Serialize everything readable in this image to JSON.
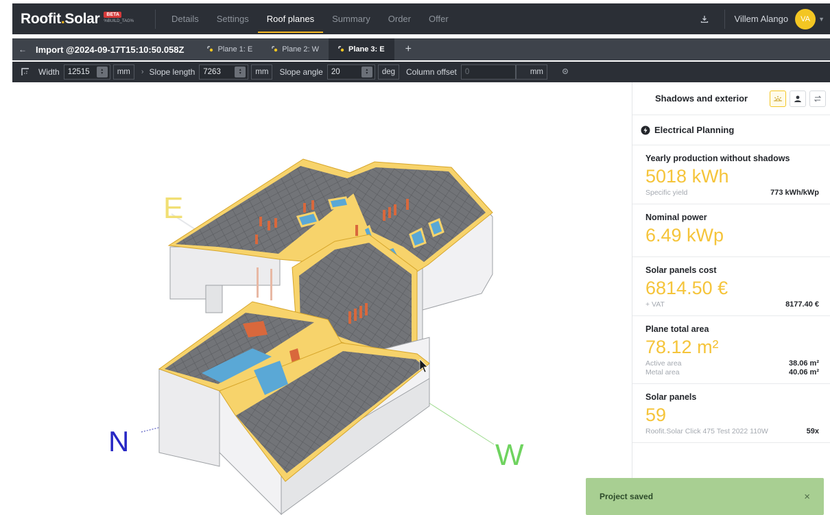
{
  "app": {
    "logo_main": "Roofit",
    "logo_dot": ".",
    "logo_end": "Solar",
    "beta": "BETA",
    "build_tag": "%BUILD_TAG%"
  },
  "nav": {
    "tabs": [
      "Details",
      "Settings",
      "Roof planes",
      "Summary",
      "Order",
      "Offer"
    ],
    "active": "Roof planes",
    "user_name": "Villem Alango",
    "user_initials": "VA"
  },
  "planebar": {
    "import_title": "Import @2024-09-17T15:10:50.058Z",
    "planes": [
      "Plane 1: E",
      "Plane 2: W",
      "Plane 3: E"
    ],
    "active_plane": "Plane 3: E",
    "add_label": "+"
  },
  "toolbar": {
    "width_label": "Width",
    "width_value": "12515",
    "width_unit": "mm",
    "slope_length_label": "Slope length",
    "slope_length_value": "7263",
    "slope_length_unit": "mm",
    "slope_angle_label": "Slope angle",
    "slope_angle_value": "20",
    "slope_angle_unit": "deg",
    "column_offset_label": "Column offset",
    "column_offset_value": "0",
    "column_offset_unit": "mm"
  },
  "viewport": {
    "compass_e": "E",
    "compass_n": "N",
    "compass_w": "W",
    "colors": {
      "roof_edge": "#f7d36b",
      "panel": "#6d6f73",
      "window": "#5aa8d6",
      "chimney": "#d9683c",
      "wall": "#e9eaec"
    }
  },
  "panel": {
    "title": "Shadows and exterior",
    "electrical_planning": "Electrical Planning",
    "yearly": {
      "label": "Yearly production without shadows",
      "value": "5018 kWh",
      "sub_key": "Specific yield",
      "sub_value": "773 kWh/kWp"
    },
    "nominal": {
      "label": "Nominal power",
      "value": "6.49 kWp"
    },
    "cost": {
      "label": "Solar panels cost",
      "value": "6814.50 €",
      "sub_key": "+ VAT",
      "sub_value": "8177.40 €"
    },
    "area": {
      "label": "Plane total area",
      "value": "78.12 m²",
      "active_key": "Active area",
      "active_value": "38.06 m²",
      "metal_key": "Metal area",
      "metal_value": "40.06 m²"
    },
    "panels": {
      "label": "Solar panels",
      "value": "59",
      "sub_key": "Roofit.Solar Click 475 Test 2022 110W",
      "sub_value": "59x"
    }
  },
  "toast": {
    "text": "Project saved",
    "close": "×"
  },
  "colors": {
    "accent": "#f3c623",
    "nav_bg": "#2b2f36",
    "toast_bg": "#a8cf92"
  }
}
